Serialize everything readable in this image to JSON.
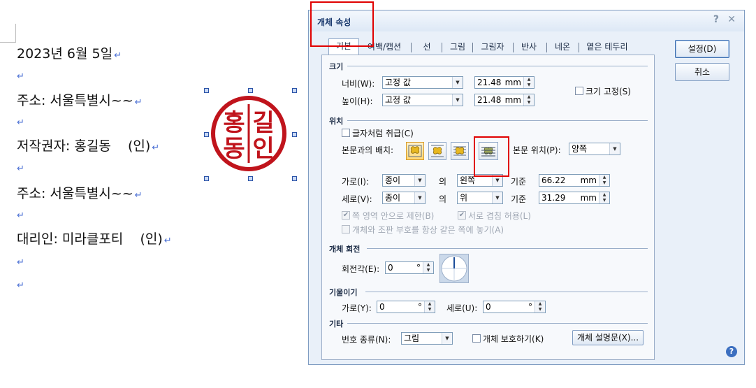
{
  "document": {
    "lines": [
      "2023년 6월 5일",
      "주소: 서울특별시~~",
      "저작권자: 홍길동    (인)",
      "주소: 서울특별시~~",
      "대리인: 미라클포티    (인)"
    ],
    "paragraph_mark": "↵",
    "stamp": {
      "chars": [
        "홍",
        "길",
        "동",
        "인"
      ],
      "color": "#c0141c"
    }
  },
  "dialog": {
    "title": "개체 속성",
    "help_icon_label": "?",
    "close_icon_label": "✕",
    "tabs": [
      "기본",
      "여백/캡션",
      "선",
      "그림",
      "그림자",
      "반사",
      "네온",
      "옅은 테두리"
    ],
    "active_tab": "기본",
    "ok_button": "설정(D)",
    "cancel_button": "취소",
    "size": {
      "title": "크기",
      "width_label": "너비(W):",
      "width_mode": "고정 값",
      "width_value": "21.48",
      "height_label": "높이(H):",
      "height_mode": "고정 값",
      "height_value": "21.48",
      "unit": "mm",
      "lock_size_label": "크기 고정(S)",
      "lock_size_checked": false
    },
    "position": {
      "title": "위치",
      "treat_as_char_label": "글자처럼 취급(C)",
      "treat_as_char_checked": false,
      "wrap_label": "본문과의 배치:",
      "wrap_selected_index": 0,
      "text_position_label": "본문 위치(P):",
      "text_position_value": "양쪽",
      "horizontal_label": "가로(I):",
      "horizontal_ref": "종이",
      "of_label": "의",
      "horizontal_align": "왼쪽",
      "basis_label": "기준",
      "horizontal_value": "66.22",
      "vertical_label": "세로(V):",
      "vertical_ref": "종이",
      "vertical_align": "위",
      "vertical_value": "31.29",
      "unit": "mm",
      "limit_label": "쪽 영역 안으로 제한(B)",
      "overlap_label": "서로 겹침 허용(L)",
      "same_side_label": "개체와 조판 부호를 항상 같은 쪽에 놓기(A)"
    },
    "rotation": {
      "title": "개체 회전",
      "angle_label": "회전각(E):",
      "angle_value": "0",
      "degree": "°"
    },
    "skew": {
      "title": "기울이기",
      "h_label": "가로(Y):",
      "h_value": "0",
      "v_label": "세로(U):",
      "v_value": "0",
      "degree": "°"
    },
    "etc": {
      "title": "기타",
      "number_type_label": "번호 종류(N):",
      "number_type_value": "그림",
      "protect_label": "개체 보호하기(K)",
      "protect_checked": false,
      "description_button": "개체 설명문(X)..."
    }
  },
  "colors": {
    "highlight_box": "#e00000",
    "dialog_bg": "#e9f0f9",
    "paragraph_mark": "#4a6fd4"
  }
}
